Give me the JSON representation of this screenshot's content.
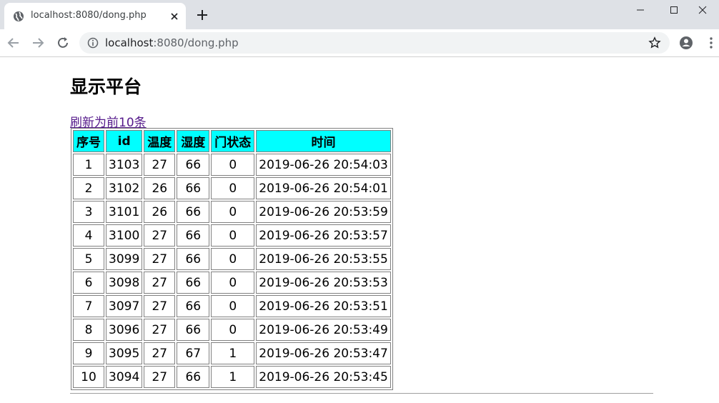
{
  "browser": {
    "tab_title": "localhost:8080/dong.php",
    "url_host": "localhost",
    "url_path": ":8080/dong.php"
  },
  "page": {
    "heading": "显示平台",
    "refresh_link": "刷新为前10条"
  },
  "table": {
    "header_bg": "#00ffff",
    "columns": [
      "序号",
      "id",
      "温度",
      "湿度",
      "门状态",
      "时间"
    ],
    "rows": [
      [
        "1",
        "3103",
        "27",
        "66",
        "0",
        "2019-06-26 20:54:03"
      ],
      [
        "2",
        "3102",
        "26",
        "66",
        "0",
        "2019-06-26 20:54:01"
      ],
      [
        "3",
        "3101",
        "26",
        "66",
        "0",
        "2019-06-26 20:53:59"
      ],
      [
        "4",
        "3100",
        "27",
        "66",
        "0",
        "2019-06-26 20:53:57"
      ],
      [
        "5",
        "3099",
        "27",
        "66",
        "0",
        "2019-06-26 20:53:55"
      ],
      [
        "6",
        "3098",
        "27",
        "66",
        "0",
        "2019-06-26 20:53:53"
      ],
      [
        "7",
        "3097",
        "27",
        "66",
        "0",
        "2019-06-26 20:53:51"
      ],
      [
        "8",
        "3096",
        "27",
        "66",
        "0",
        "2019-06-26 20:53:49"
      ],
      [
        "9",
        "3095",
        "27",
        "67",
        "1",
        "2019-06-26 20:53:47"
      ],
      [
        "10",
        "3094",
        "27",
        "66",
        "1",
        "2019-06-26 20:53:45"
      ]
    ]
  },
  "icons": {
    "tab_favicon": "globe-icon",
    "tab_close": "close-icon",
    "new_tab": "plus-icon",
    "back": "back-arrow-icon",
    "forward": "forward-arrow-icon",
    "reload": "reload-icon",
    "site_info": "info-icon",
    "bookmark": "star-icon",
    "account": "account-icon",
    "menu": "kebab-menu-icon"
  }
}
